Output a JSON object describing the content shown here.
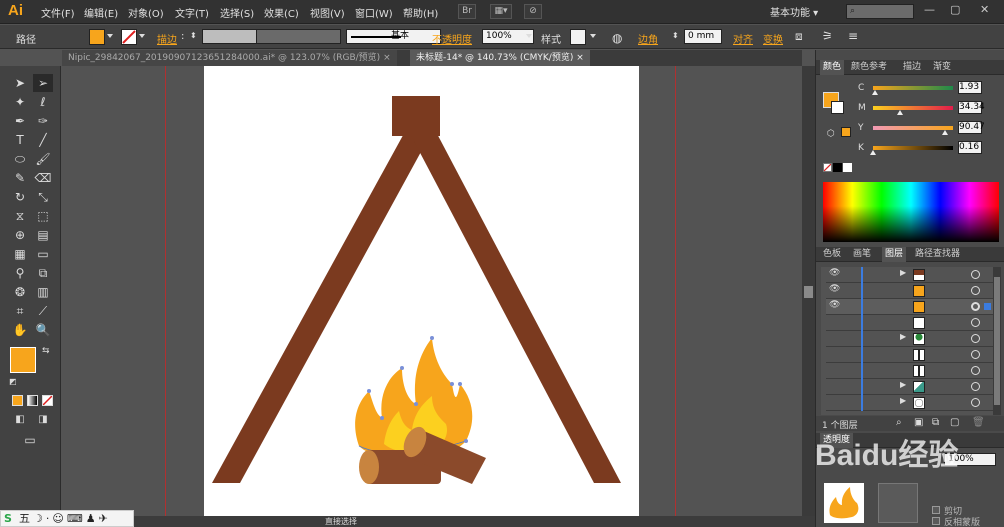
{
  "app": {
    "logo": "Ai",
    "workspace": "基本功能"
  },
  "menu": [
    "文件(F)",
    "编辑(E)",
    "对象(O)",
    "文字(T)",
    "选择(S)",
    "效果(C)",
    "视图(V)",
    "窗口(W)",
    "帮助(H)"
  ],
  "menu_buttons": {
    "br": "Br",
    "st": "St"
  },
  "control_bar": {
    "selection": "路径",
    "stroke_label": "描边",
    "stroke_style": "基本",
    "opacity_label": "不透明度",
    "opacity_value": "100%",
    "style_label": "样式",
    "corner_label": "边角",
    "corner_value": "0 mm",
    "align": "对齐",
    "transform": "变换"
  },
  "tabs": [
    "Nipic_29842067_20190907123651284000.ai* @ 123.07% (RGB/预览)",
    "未标题-14* @ 140.73% (CMYK/预览)"
  ],
  "colors": {
    "fill": "#f7a51c",
    "brown": "#7b3a1f",
    "log": "#8b4a2b",
    "log_cap": "#c8843f",
    "flame_outer": "#f7a51c",
    "flame_inner": "#fcd01f"
  },
  "color_panel": {
    "tabs": [
      "颜色",
      "颜色参考",
      "描边",
      "渐变"
    ],
    "channels": [
      {
        "label": "C",
        "value": "1.93",
        "pos": 0.02
      },
      {
        "label": "M",
        "value": "34.34",
        "pos": 0.34
      },
      {
        "label": "Y",
        "value": "90.47",
        "pos": 0.9
      },
      {
        "label": "K",
        "value": "0.16",
        "pos": 0.0
      }
    ]
  },
  "layers_panel": {
    "tabs": [
      "色板",
      "画笔",
      "图层",
      "路径查找器"
    ],
    "status": "1 个图层"
  },
  "bottom_panel": {
    "tab": "透明度",
    "opacity": "100%",
    "option1": "剪切",
    "option2": "反相蒙版"
  },
  "status": {
    "tool": "直接选择"
  },
  "ime": {
    "text": "五"
  },
  "watermark": "Baidu经验"
}
